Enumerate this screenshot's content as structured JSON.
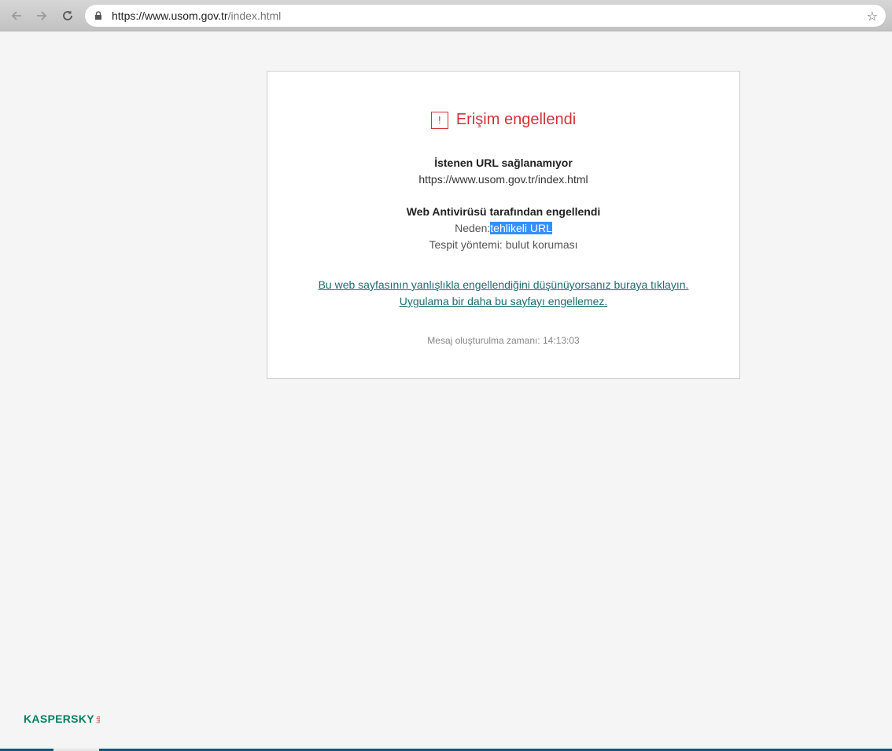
{
  "browser": {
    "url_host": "https://www.usom.gov.tr",
    "url_path": "/index.html",
    "back_icon": "back-arrow-icon",
    "forward_icon": "forward-arrow-icon",
    "reload_icon": "reload-icon",
    "lock_icon": "lock-icon",
    "bookmark_icon": "star-icon"
  },
  "block_page": {
    "warning_glyph": "!",
    "title": "Erişim engellendi",
    "unavailable_heading": "İstenen URL sağlanamıyor",
    "requested_url": "https://www.usom.gov.tr/index.html",
    "blocked_by_heading": "Web Antivirüsü tarafından engellendi",
    "reason_label": "Neden:",
    "reason_value": "tehlikeli URL",
    "detection_method": "Tespit yöntemi: bulut koruması",
    "report_link_line1": "Bu web sayfasının yanlışlıkla engellendiğini düşünüyorsanız buraya tıklayın.",
    "report_link_line2": "Uygulama bir daha bu sayfayı engellemez.",
    "timestamp": "Mesaj oluşturulma zamanı: 14:13:03"
  },
  "footer": {
    "logo_text": "KASPERSKY",
    "logo_sub": "lab"
  },
  "colors": {
    "alert_red": "#d2333a",
    "link_teal": "#1e6c6d",
    "selection_blue": "#3390ff",
    "kaspersky_green": "#00805f"
  }
}
